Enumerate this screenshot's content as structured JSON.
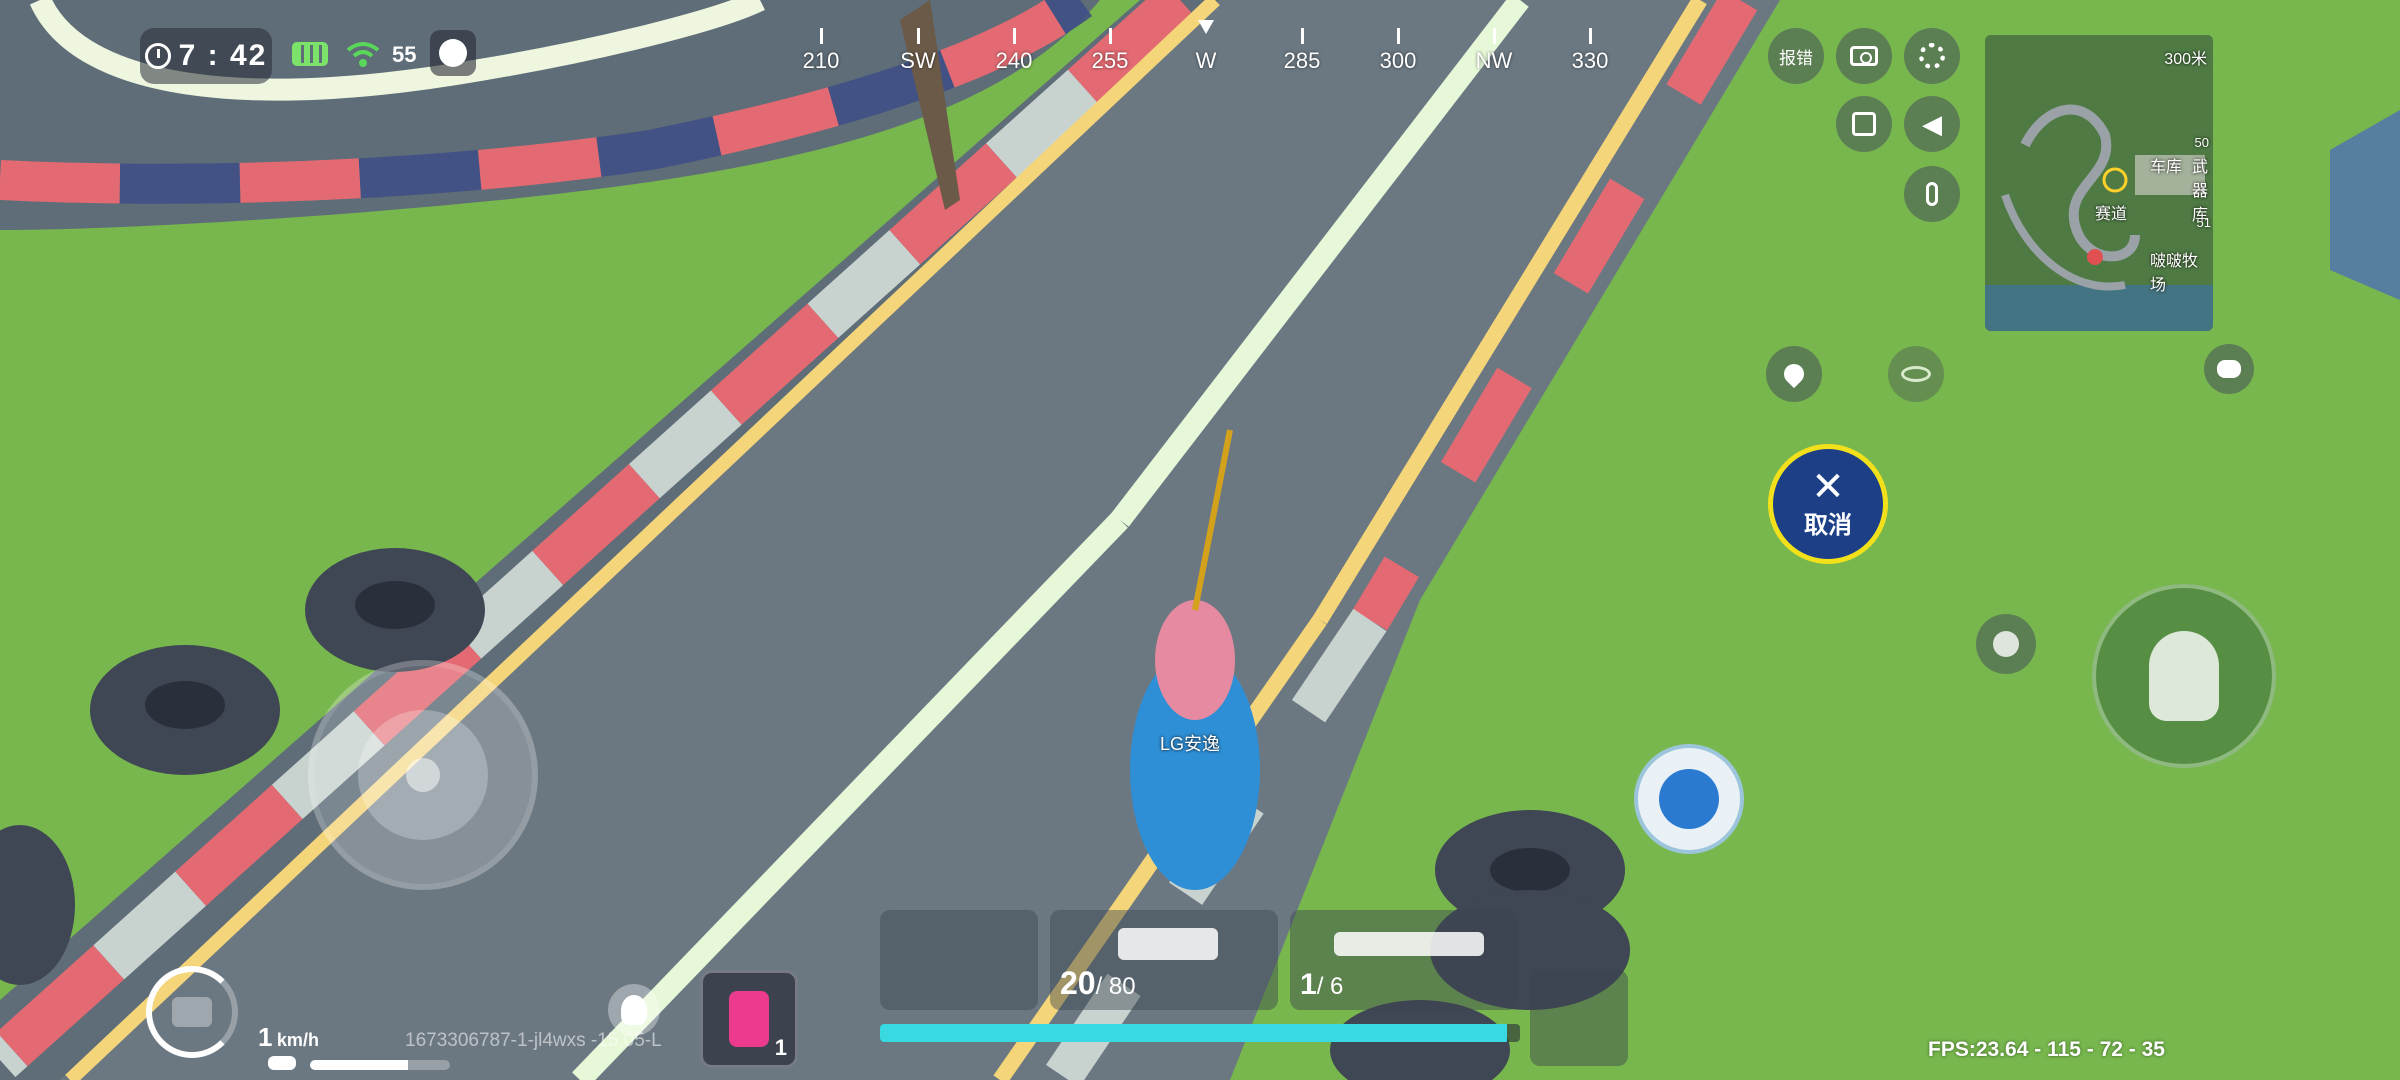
{
  "status_bar": {
    "time": "7 : 42",
    "signal": "55"
  },
  "compass": {
    "ticks": [
      "210",
      "SW",
      "240",
      "255",
      "W",
      "285",
      "300",
      "NW",
      "330"
    ]
  },
  "top_buttons": {
    "report_label": "报错"
  },
  "minimap": {
    "scale": "300米",
    "labels": {
      "shop": "车库",
      "armory": "武器库",
      "track": "赛道",
      "ranch": "啵啵牧场",
      "marker_50": "50",
      "marker_51": "51"
    }
  },
  "cancel_button": {
    "label": "取消"
  },
  "player": {
    "name": "LG安逸"
  },
  "speed": {
    "value": "1",
    "unit": "km/h",
    "fuel_fraction": 0.7
  },
  "build_id": "1673306787-1-jl4wxs -15.05-L",
  "inventory": {
    "item_count": "1"
  },
  "weapons": {
    "slot2_ammo_current": "20",
    "slot2_ammo_total": "/ 80",
    "slot3_ammo_current": "1",
    "slot3_ammo_total": "/ 6"
  },
  "health": {
    "fraction": 0.98,
    "color": "#38d9e0"
  },
  "fps": "FPS:23.64 - 115 - 72 - 35"
}
